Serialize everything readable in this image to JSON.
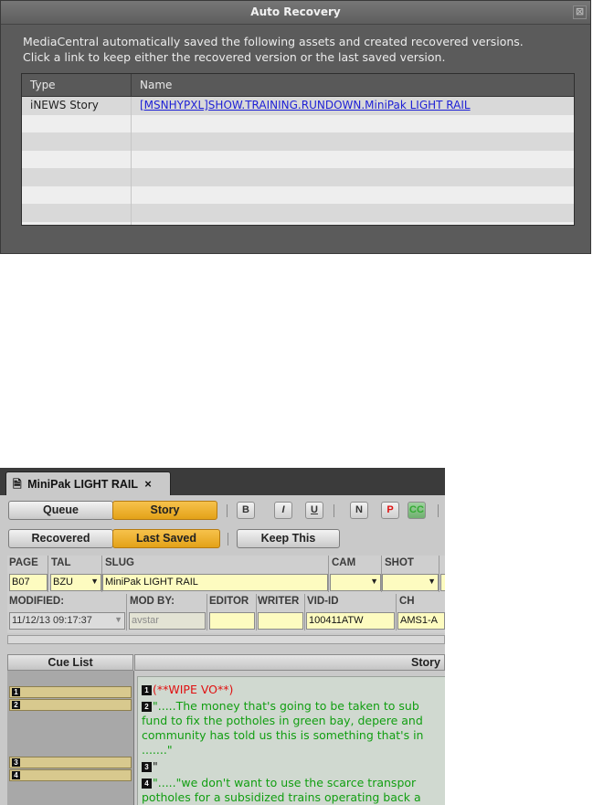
{
  "dialog": {
    "title": "Auto Recovery",
    "close_glyph": "⊠",
    "message_line1": "MediaCentral automatically saved the following assets and created recovered versions.",
    "message_line2": "Click a link to keep either the recovered version or the last saved version.",
    "columns": [
      "Type",
      "Name"
    ],
    "rows": [
      {
        "type": "iNEWS Story",
        "name": "[MSNHYPXL]SHOW.TRAINING.RUNDOWN.MiniPak LIGHT RAIL"
      }
    ]
  },
  "story_panel": {
    "tab_icon": "🗎",
    "tab_title": "MiniPak LIGHT RAIL",
    "tab_close": "×",
    "queue_label": "Queue",
    "story_label": "Story",
    "format_buttons": [
      "B",
      "I",
      "U",
      "N",
      "P",
      "CC"
    ],
    "recovered_label": "Recovered",
    "last_saved_label": "Last Saved",
    "keep_this_label": "Keep This",
    "active_view": "Story",
    "active_version": "Last Saved",
    "fields": {
      "page_label": "PAGE",
      "page_value": "B07",
      "tal_label": "TAL",
      "tal_value": "BZU",
      "slug_label": "SLUG",
      "slug_value": "MiniPak LIGHT RAIL",
      "cam_label": "CAM",
      "cam_value": "",
      "shot_label": "SHOT",
      "shot_value": "",
      "modified_label": "MODIFIED:",
      "modified_value": "11/12/13 09:17:37",
      "modby_label": "MOD BY:",
      "modby_value": "avstar",
      "editor_label": "EDITOR",
      "editor_value": "",
      "writer_label": "WRITER",
      "writer_value": "",
      "vidid_label": "VID-ID",
      "vidid_value": "100411ATW",
      "ch_label": "CH",
      "ch_value": "AMS1-A"
    },
    "cue_list_header": "Cue List",
    "story_header": "Story",
    "cue_items": [
      "1",
      "2",
      "3",
      "4"
    ],
    "story_lines": [
      {
        "num": "1",
        "text": "(**WIPE VO**)",
        "color": "red"
      },
      {
        "num": "2",
        "text": "\".....The money that's going to be taken to sub",
        "color": "green"
      },
      {
        "num": "",
        "text": "fund to fix the potholes in green bay, depere and",
        "color": "green"
      },
      {
        "num": "",
        "text": "community has told us this is something that's in",
        "color": "green"
      },
      {
        "num": "",
        "text": ".......\"",
        "color": "green"
      },
      {
        "num": "3",
        "text": "\"",
        "color": "black"
      },
      {
        "num": "4",
        "text": "\".....\"we don't want to use the scarce transpor",
        "color": "green"
      },
      {
        "num": "",
        "text": "potholes for a subsidized trains operating back a",
        "color": "green"
      }
    ]
  }
}
